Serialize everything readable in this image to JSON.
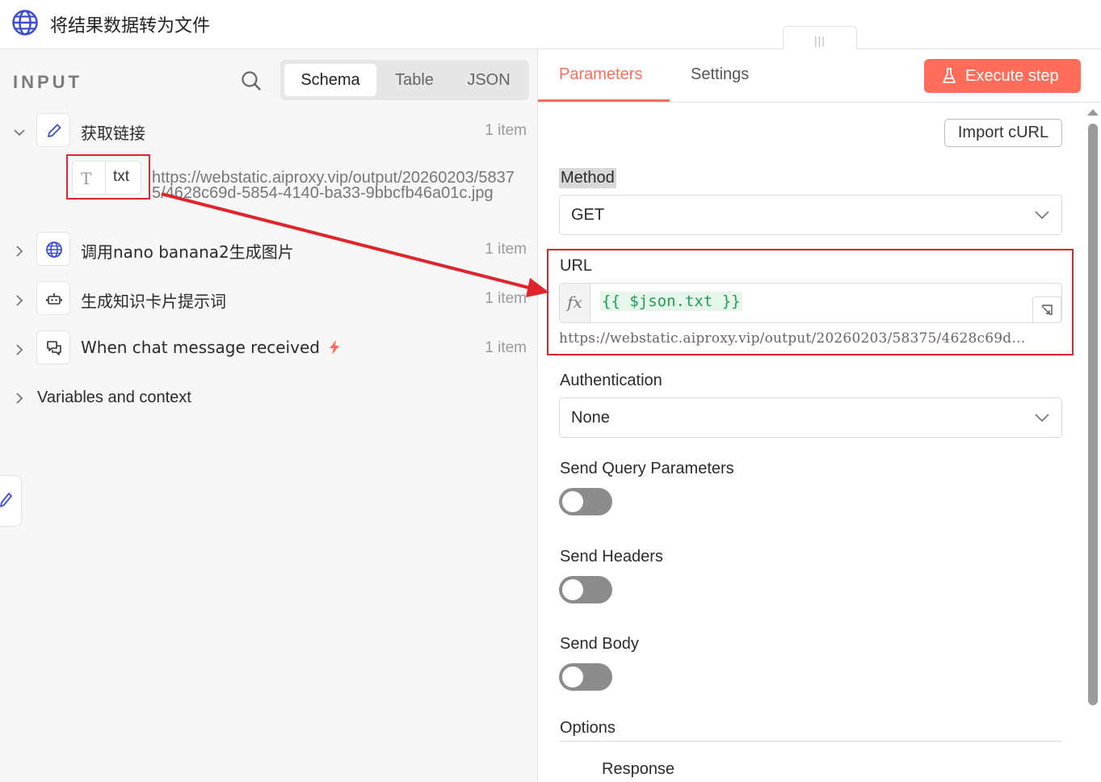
{
  "window": {
    "title": "将结果数据转为文件",
    "drag_handle": "|||"
  },
  "left_panel": {
    "input_label": "INPUT",
    "view_tabs": [
      {
        "label": "Schema",
        "active": true
      },
      {
        "label": "Table",
        "active": false
      },
      {
        "label": "JSON",
        "active": false
      }
    ],
    "nodes": [
      {
        "name": "获取链接",
        "count": "1 item",
        "expanded": true,
        "icon": "pencil-icon"
      },
      {
        "name": "调用nano banana2生成图片",
        "count": "1 item",
        "expanded": false,
        "icon": "globe-icon"
      },
      {
        "name": "生成知识卡片提示词",
        "count": "1 item",
        "expanded": false,
        "icon": "robot-icon"
      },
      {
        "name": "When chat message received",
        "count": "1 item",
        "expanded": false,
        "icon": "chat-icon",
        "trigger": true
      }
    ],
    "field": {
      "type_icon": "T",
      "name": "txt",
      "value": "https://webstatic.aiproxy.vip/output/20260203/58375/4628c69d-5854-4140-ba33-9bbcfb46a01c.jpg"
    },
    "variables_label": "Variables and context"
  },
  "right_panel": {
    "tabs": [
      {
        "label": "Parameters",
        "active": true
      },
      {
        "label": "Settings",
        "active": false
      }
    ],
    "execute_label": "Execute step",
    "import_curl_label": "Import cURL",
    "method": {
      "label": "Method",
      "value": "GET"
    },
    "url": {
      "label": "URL",
      "fx": "fx",
      "expression": "{{ $json.txt }}",
      "preview": "https://webstatic.aiproxy.vip/output/20260203/58375/4628c69d…"
    },
    "authentication": {
      "label": "Authentication",
      "value": "None"
    },
    "toggles": [
      {
        "label": "Send Query Parameters",
        "on": false
      },
      {
        "label": "Send Headers",
        "on": false
      },
      {
        "label": "Send Body",
        "on": false
      }
    ],
    "options_label": "Options",
    "response_label": "Response"
  },
  "colors": {
    "accent": "#ff6d5a",
    "annotation_red": "#e0242b",
    "expression_green": "#1f9d55",
    "icon_blue": "#3b4cd6"
  }
}
